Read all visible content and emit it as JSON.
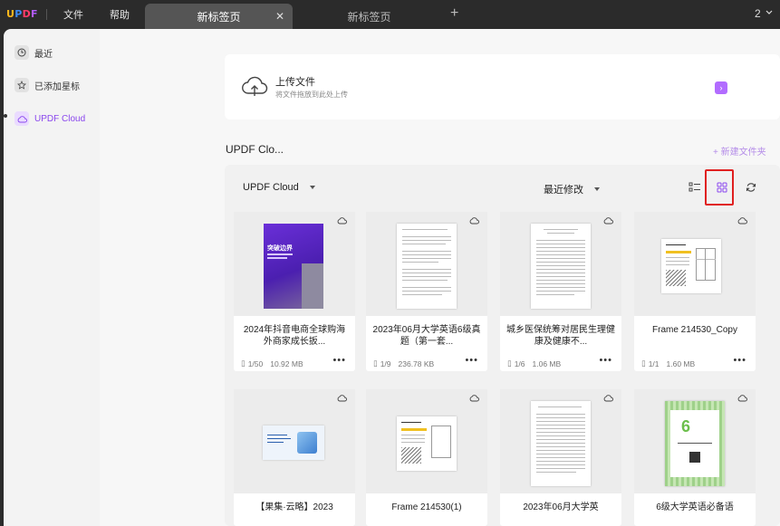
{
  "app": {
    "logo": {
      "u": "U",
      "p": "P",
      "d": "D",
      "f": "F"
    },
    "menu": [
      "文件",
      "帮助"
    ],
    "tabs": [
      {
        "label": "新标签页",
        "active": true
      },
      {
        "label": "新标签页",
        "active": false
      }
    ],
    "window_count": "2"
  },
  "sidebar": {
    "items": [
      {
        "label": "最近",
        "icon": "clock-icon"
      },
      {
        "label": "已添加星标",
        "icon": "star-icon"
      },
      {
        "label": "UPDF Cloud",
        "icon": "cloud-icon",
        "active": true
      }
    ]
  },
  "upload": {
    "title": "上传文件",
    "subtitle": "将文件拖放到此处上传"
  },
  "section": {
    "title": "UPDF Clo...",
    "new_folder": "+ 新建文件夹"
  },
  "toolbar": {
    "location": "UPDF Cloud",
    "sort": "最近修改"
  },
  "files": [
    {
      "title": "2024年抖音电商全球购海外商家成长扳...",
      "pages": "1/50",
      "size": "10.92 MB",
      "cover_text": "突破边界"
    },
    {
      "title": "2023年06月大学英语6级真题（第一套...",
      "pages": "1/9",
      "size": "236.78 KB"
    },
    {
      "title": "城乡医保统筹对居民生理健康及健康不...",
      "pages": "1/6",
      "size": "1.06 MB"
    },
    {
      "title": "Frame 214530_Copy",
      "pages": "1/1",
      "size": "1.60 MB"
    },
    {
      "title": "【果集·云略】2023"
    },
    {
      "title": "Frame 214530(1)"
    },
    {
      "title": "2023年06月大学英"
    },
    {
      "title": "6级大学英语必备语"
    }
  ],
  "colors": {
    "accent": "#8a47ee",
    "highlight": "#e02020"
  }
}
